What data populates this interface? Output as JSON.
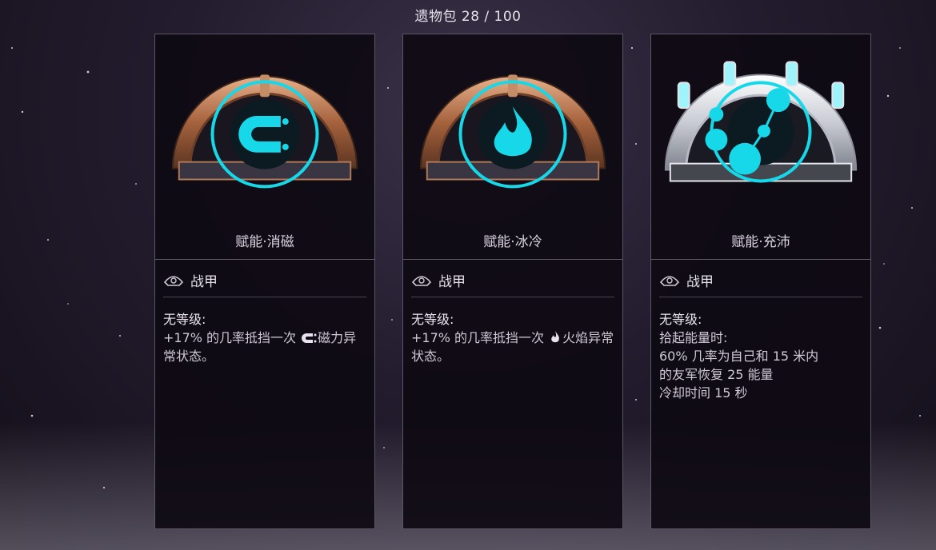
{
  "header": {
    "text": "遗物包 28 / 100"
  },
  "colors": {
    "accent": "#16d8e8",
    "card_border": "#5a5464",
    "text": "#d9d3e0"
  },
  "cards": [
    {
      "name": "赋能·消磁",
      "emblem_icon": "magnet-icon",
      "frame": "bronze",
      "type": "战甲",
      "desc_title": "无等级:",
      "desc_line1": "+17% 的几率抵挡一次",
      "desc_suffix": "磁力异常状态。",
      "desc_extra": []
    },
    {
      "name": "赋能·冰冷",
      "emblem_icon": "flame-icon",
      "frame": "bronze",
      "type": "战甲",
      "desc_title": "无等级:",
      "desc_line1": "+17% 的几率抵挡一次",
      "desc_suffix": "火焰异常状态。",
      "desc_extra": []
    },
    {
      "name": "赋能·充沛",
      "emblem_icon": "energy-orbs-icon",
      "frame": "platinum",
      "type": "战甲",
      "desc_title": "无等级:",
      "desc_line1": "拾起能量时:",
      "desc_suffix": "",
      "desc_extra": [
        "60% 几率为自己和 15 米内",
        "的友军恢复 25 能量",
        "冷却时间 15 秒"
      ]
    }
  ]
}
